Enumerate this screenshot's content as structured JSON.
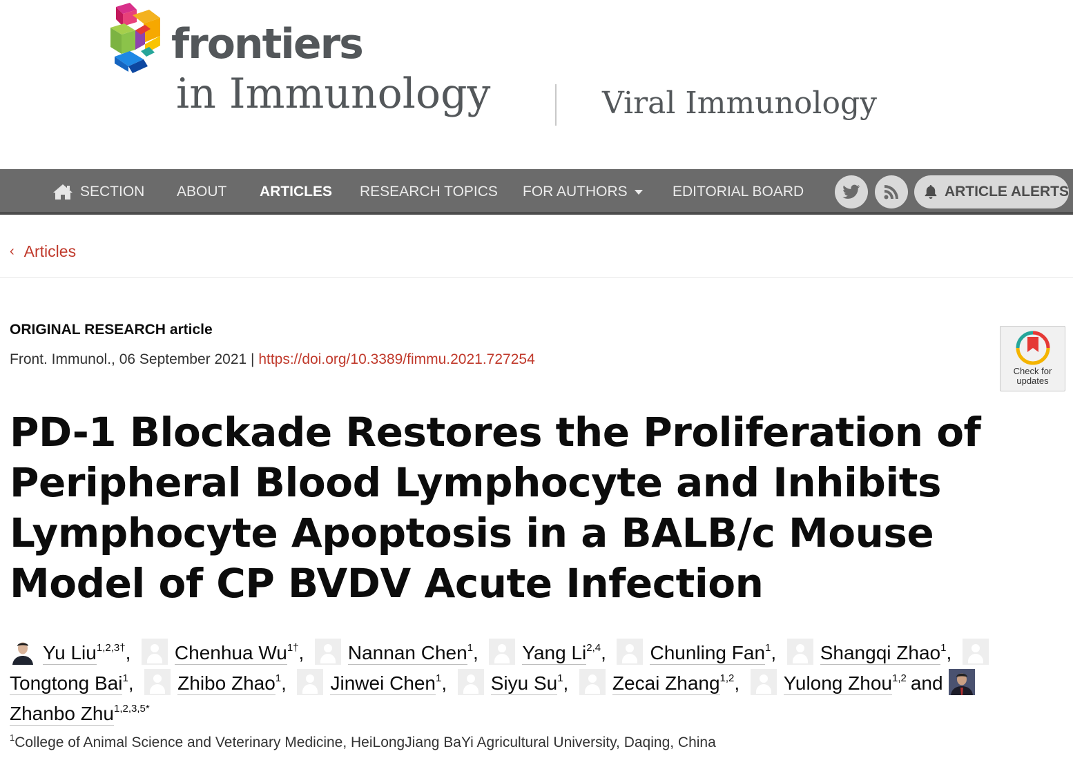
{
  "header": {
    "brand": "frontiers",
    "journal": "in Immunology",
    "section": "Viral Immunology"
  },
  "navbar": {
    "items": [
      {
        "label": "SECTION",
        "icon": "home-icon"
      },
      {
        "label": "ABOUT"
      },
      {
        "label": "ARTICLES",
        "active": true
      },
      {
        "label": "RESEARCH TOPICS"
      },
      {
        "label": "FOR AUTHORS",
        "dropdown": true
      },
      {
        "label": "EDITORIAL BOARD"
      }
    ],
    "social": [
      "twitter-icon",
      "rss-icon"
    ],
    "alerts_label": "ARTICLE ALERTS"
  },
  "breadcrumb": {
    "label": "Articles"
  },
  "article": {
    "type_bold": "ORIGINAL RESEARCH",
    "type_rest": "article",
    "citation": "Front. Immunol., 06 September 2021 | ",
    "doi": "https://doi.org/10.3389/fimmu.2021.727254",
    "check_updates": "Check for updates",
    "title": "PD-1 Blockade Restores the Proliferation of Peripheral Blood Lymphocyte and Inhibits Lymphocyte Apoptosis in a BALB/c Mouse Model of CP BVDV Acute Infection"
  },
  "authors": [
    {
      "name": "Yu Liu",
      "sup": "1,2,3†",
      "avatar": "photo"
    },
    {
      "name": "Chenhua Wu",
      "sup": "1†",
      "avatar": "blank"
    },
    {
      "name": "Nannan Chen",
      "sup": "1",
      "avatar": "blank"
    },
    {
      "name": "Yang Li",
      "sup": "2,4",
      "avatar": "blank"
    },
    {
      "name": "Chunling Fan",
      "sup": "1",
      "avatar": "blank"
    },
    {
      "name": "Shangqi Zhao",
      "sup": "1",
      "avatar": "blank"
    },
    {
      "name": "Tongtong Bai",
      "sup": "1",
      "avatar": "blank"
    },
    {
      "name": "Zhibo Zhao",
      "sup": "1",
      "avatar": "blank"
    },
    {
      "name": "Jinwei Chen",
      "sup": "1",
      "avatar": "blank"
    },
    {
      "name": "Siyu Su",
      "sup": "1",
      "avatar": "blank"
    },
    {
      "name": "Zecai Zhang",
      "sup": "1,2",
      "avatar": "blank"
    },
    {
      "name": "Yulong Zhou",
      "sup": "1,2",
      "avatar": "blank"
    },
    {
      "name": "Zhanbo Zhu",
      "sup": "1,2,3,5*",
      "avatar": "photo"
    }
  ],
  "and_word": "and",
  "affiliation": {
    "sup": "1",
    "text": "College of Animal Science and Veterinary Medicine, HeiLongJiang BaYi Agricultural University, Daqing, China"
  },
  "colors": {
    "nav_bg": "#6b6b6b",
    "link_red": "#c0392b",
    "brand_gray": "#53575a"
  }
}
